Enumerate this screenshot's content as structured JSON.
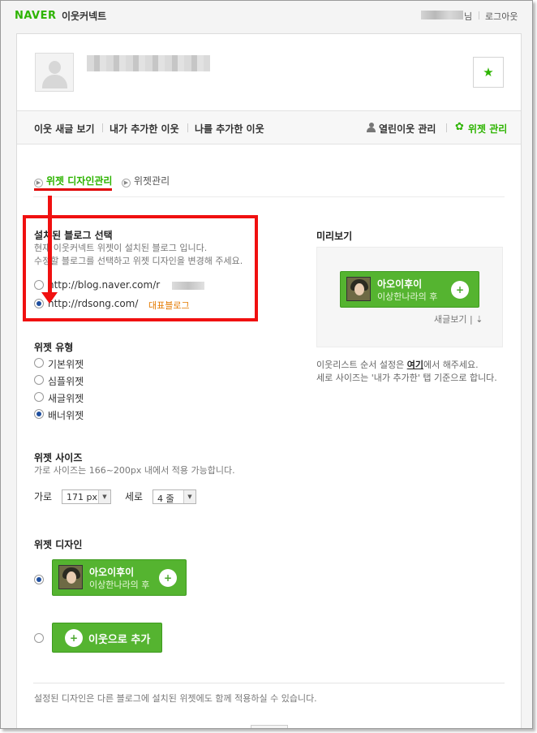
{
  "header": {
    "logo": "NAVER",
    "service": "이웃커넥트",
    "user_suffix": "님",
    "logout": "로그아웃"
  },
  "profile": {
    "star_icon": "★"
  },
  "nav": {
    "items": [
      "이웃 새글 보기",
      "내가 추가한 이웃",
      "나를 추가한 이웃"
    ],
    "open_manage": "열린이웃 관리",
    "widget_manage": "위젯 관리"
  },
  "subtabs": {
    "design": "위젯 디자인관리",
    "widget": "위젯관리"
  },
  "blog_select": {
    "title": "설치된 블로그 선택",
    "desc_line1": "현재 이웃커넥트 위젯이 설치된 블로그 입니다.",
    "desc_line2": "수정할 블로그를 선택하고 위젯 디자인을 변경해 주세요.",
    "options": [
      "http://blog.naver.com/r",
      "http://rdsong.com/"
    ],
    "selected_index": 1,
    "primary_badge": "대표블로그"
  },
  "widget_type": {
    "title": "위젯 유형",
    "options": [
      "기본위젯",
      "심플위젯",
      "새글위젯",
      "배너위젯"
    ],
    "selected_index": 3
  },
  "widget_size": {
    "title": "위젯 사이즈",
    "desc": "가로 사이즈는 166~200px 내에서 적용 가능합니다.",
    "width_label": "가로",
    "width_value": "171 px",
    "height_label": "세로",
    "height_value": "4 줄"
  },
  "widget_design": {
    "title": "위젯 디자인",
    "banner_title": "아오이후이",
    "banner_sub": "이상한나라의 후",
    "add_button": "이웃으로 추가",
    "selected_index": 0
  },
  "preview": {
    "title": "미리보기",
    "banner_title": "아오이후이",
    "banner_sub": "이상한나라의 후",
    "new_posts": "새글보기",
    "note_pre": "이웃리스트 순서 설정은 ",
    "note_link": "여기",
    "note_post": "에서 해주세요.",
    "note_line2": "세로 사이즈는 '내가 추가한' 탭 기준으로 합니다."
  },
  "footer": {
    "note": "설정된 디자인은 다른 블로그에 설치된 위젯에도 함께 적용하실 수 있습니다."
  },
  "colors": {
    "naver_green": "#2db400",
    "annotation_red": "#f01010",
    "badge_orange": "#e47a00"
  }
}
